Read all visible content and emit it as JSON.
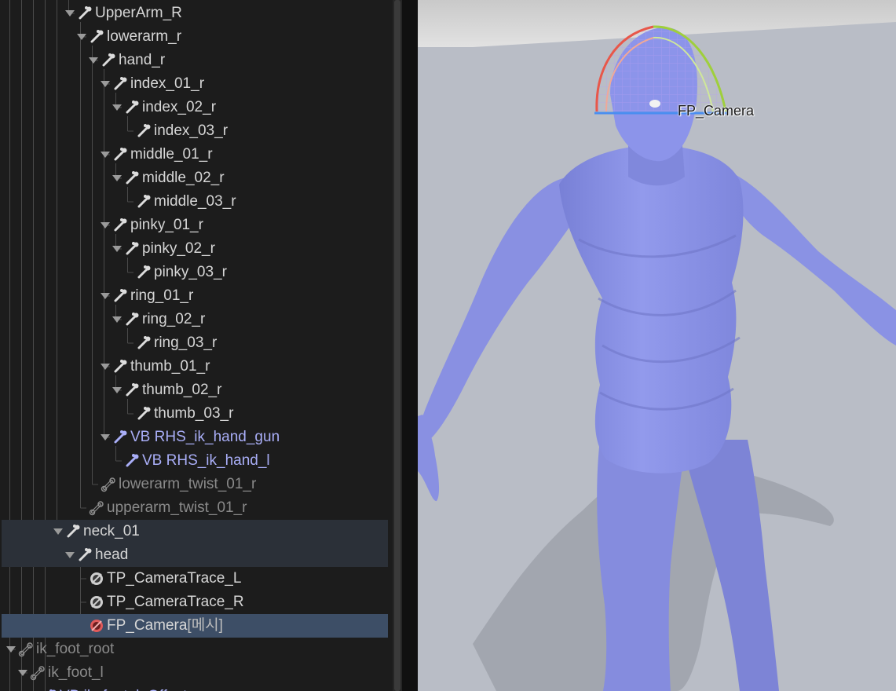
{
  "skeleton_tree": {
    "rows": [
      {
        "label": "UpperArm_R"
      },
      {
        "label": "lowerarm_r"
      },
      {
        "label": "hand_r"
      },
      {
        "label": "index_01_r"
      },
      {
        "label": "index_02_r"
      },
      {
        "label": "index_03_r"
      },
      {
        "label": "middle_01_r"
      },
      {
        "label": "middle_02_r"
      },
      {
        "label": "middle_03_r"
      },
      {
        "label": "pinky_01_r"
      },
      {
        "label": "pinky_02_r"
      },
      {
        "label": "pinky_03_r"
      },
      {
        "label": "ring_01_r"
      },
      {
        "label": "ring_02_r"
      },
      {
        "label": "ring_03_r"
      },
      {
        "label": "thumb_01_r"
      },
      {
        "label": "thumb_02_r"
      },
      {
        "label": "thumb_03_r"
      },
      {
        "label": "VB RHS_ik_hand_gun"
      },
      {
        "label": "VB RHS_ik_hand_l"
      },
      {
        "label": "lowerarm_twist_01_r"
      },
      {
        "label": "upperarm_twist_01_r"
      },
      {
        "label": "neck_01"
      },
      {
        "label": "head"
      },
      {
        "label": "TP_CameraTrace_L"
      },
      {
        "label": "TP_CameraTrace_R"
      },
      {
        "label": "FP_Camera",
        "tag": "[메시]"
      },
      {
        "label": "ik_foot_root"
      },
      {
        "label": "ik_foot_l"
      },
      {
        "label": "VB ik_foot_l_Offset"
      }
    ]
  },
  "viewport": {
    "socket_label": "FP_Camera",
    "colors": {
      "floor": "#b9bdc6",
      "mannequin": "#8e96e6",
      "gizmo_red": "#e8574a",
      "gizmo_green": "#9fcf3c",
      "gizmo_blue": "#4a8ef0"
    }
  }
}
